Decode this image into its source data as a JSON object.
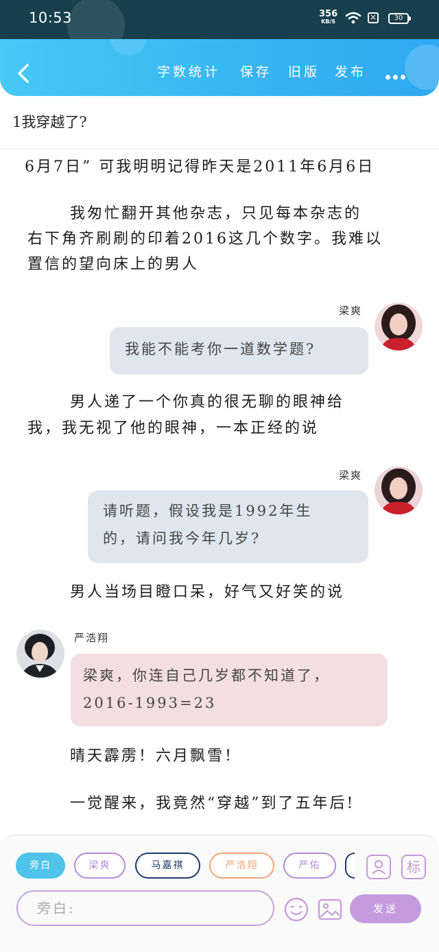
{
  "status_bar": {
    "time": "10:53",
    "net_speed": "356",
    "net_unit": "KB/S",
    "battery": "30"
  },
  "header": {
    "actions": [
      "字数统计",
      "保存",
      "旧版",
      "发布"
    ]
  },
  "chapter": {
    "title": "1我穿越了?"
  },
  "content": {
    "p1": "6月7日” 可我明明记得昨天是2011年6月6日",
    "p2_l1": "我匆忙翻开其他杂志，只见每本杂志的",
    "p2_l2": "右下角齐刷刷的印着2016这几个数字。我难以",
    "p2_l3": "置信的望向床上的男人",
    "msg1_name": "梁爽",
    "msg1_text": "我能不能考你一道数学题?",
    "p3_l1": "男人递了一个你真的很无聊的眼神给",
    "p3_l2": "我，我无视了他的眼神，一本正经的说",
    "msg2_name": "梁爽",
    "msg2_l1": "请听题，假设我是1992年生",
    "msg2_l2": "的，请问我今年几岁?",
    "p4": "男人当场目瞪口呆，好气又好笑的说",
    "msg3_name": "严浩翔",
    "msg3_l1": "梁爽，你连自己几岁都不知道了，",
    "msg3_l2": "2016-1993=23",
    "p5": "晴天霹雳！六月飘雪！",
    "p6": "一觉醒来，我竟然“穿越”到了五年后!"
  },
  "characters": {
    "chips": [
      {
        "label": "旁白",
        "active": true,
        "color": "#4fc3ea"
      },
      {
        "label": "梁爽",
        "active": false,
        "color": "#b58ad6"
      },
      {
        "label": "马嘉祺",
        "active": false,
        "color": "#1d3a6b"
      },
      {
        "label": "严浩翔",
        "active": false,
        "color": "#f0a57a"
      },
      {
        "label": "严佑",
        "active": false,
        "color": "#b58ad6"
      }
    ]
  },
  "composer": {
    "placeholder": "旁白:",
    "send_label": "发送"
  },
  "icons": {
    "profile": "profile-card-icon",
    "tag": "tag-icon",
    "emoji": "emoji-icon",
    "image": "image-icon"
  },
  "tag_label": "标"
}
